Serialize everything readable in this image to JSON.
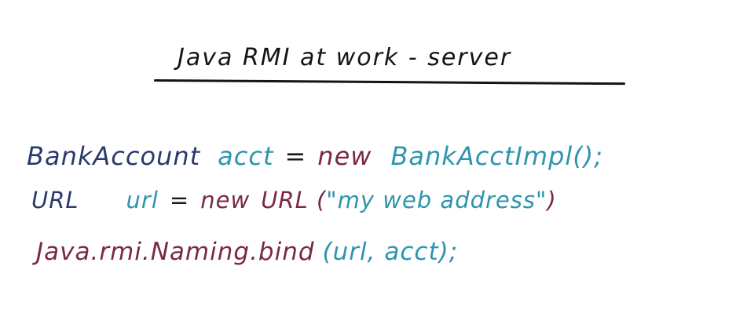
{
  "title": "Java RMI at work - server",
  "lines": [
    {
      "type": "BankAccount",
      "var": "acct",
      "eq": "=",
      "new_kw": "new",
      "ctor": "BankAcctImpl();"
    },
    {
      "type": "URL",
      "var": "url",
      "eq": "=",
      "new_kw": "new",
      "ctor": "URL (",
      "arg": "\"my web address\"",
      "close": ")"
    },
    {
      "call": "Java.rmi.Naming.bind",
      "args_open": "(",
      "args": "url, acct",
      "args_close": ");"
    }
  ],
  "colors": {
    "title": "#141414",
    "navy": "#2a3a6b",
    "teal": "#2e95ad",
    "maroon": "#7a2748"
  }
}
